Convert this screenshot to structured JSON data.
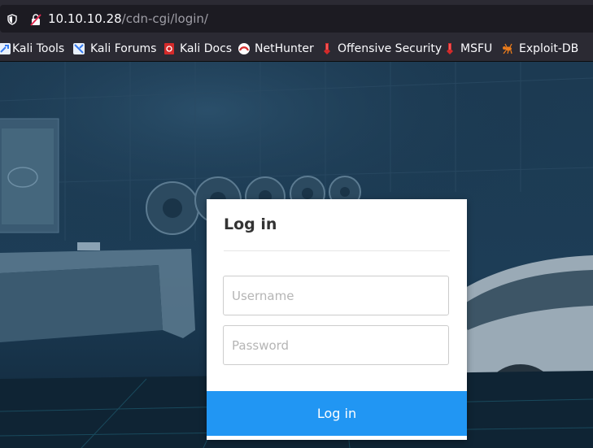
{
  "urlbar": {
    "host": "10.10.10.28",
    "path": "/cdn-cgi/login/"
  },
  "bookmarks": [
    {
      "label": "Kali Tools",
      "icon": "kali-tools-icon"
    },
    {
      "label": "Kali Forums",
      "icon": "kali-forums-icon"
    },
    {
      "label": "Kali Docs",
      "icon": "kali-docs-icon"
    },
    {
      "label": "NetHunter",
      "icon": "nethunter-icon"
    },
    {
      "label": "Offensive Security",
      "icon": "offensive-security-icon"
    },
    {
      "label": "MSFU",
      "icon": "msfu-icon"
    },
    {
      "label": "Exploit-DB",
      "icon": "exploit-db-icon"
    }
  ],
  "login": {
    "title": "Log in",
    "username_placeholder": "Username",
    "password_placeholder": "Password",
    "button_label": "Log in"
  },
  "colors": {
    "accent": "#2196f3",
    "background": "#173248",
    "toolbar": "#2b2a33"
  }
}
